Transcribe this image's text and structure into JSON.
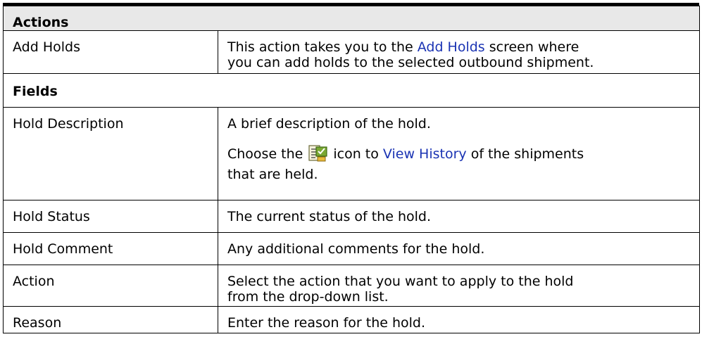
{
  "sections": {
    "actions_title": "Actions",
    "fields_title": "Fields"
  },
  "actions": [
    {
      "name": "Add Holds",
      "desc_before": "This action takes you to the ",
      "desc_link": "Add Holds",
      "desc_line1_after": " screen where",
      "desc_line2": "you can add holds to the selected outbound shipment."
    }
  ],
  "fields": [
    {
      "name": "Hold Description",
      "desc": "A brief description of the hold.",
      "extra_before": "Choose the",
      "extra_icon": "view-history-icon",
      "extra_mid": "icon to ",
      "extra_link": "View History",
      "extra_after": " of the shipments",
      "extra_line2": "that are held."
    },
    {
      "name": "Hold Status",
      "desc": "The current status of the hold."
    },
    {
      "name": "Hold Comment",
      "desc": "Any additional comments for the hold."
    },
    {
      "name": "Action",
      "desc_line1": "Select the action that you want to apply to the hold",
      "desc_line2": "from the drop-down list."
    },
    {
      "name": "Reason",
      "desc": "Enter the reason for the hold."
    }
  ],
  "colors": {
    "link": "#1a33b3",
    "section_bg": "#e8e8e8",
    "border": "#000000"
  }
}
